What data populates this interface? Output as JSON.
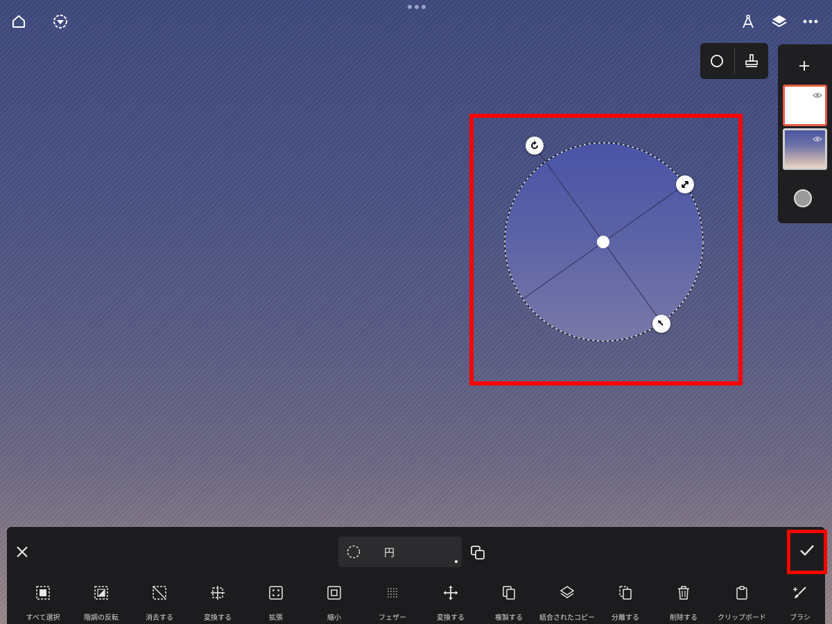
{
  "header": {
    "home_icon": "home-icon",
    "adjust_icon": "adjust-icon",
    "compass_icon": "compass-icon",
    "layers_icon": "layers-icon",
    "more_icon": "more-icon"
  },
  "tool_popover": {
    "shape_icon": "circle-outline-icon",
    "stamp_icon": "stamp-icon"
  },
  "layers_panel": {
    "add_icon": "plus-icon",
    "layers": [
      {
        "name": "layer-white",
        "selected": true,
        "visible": true
      },
      {
        "name": "layer-gradient",
        "selected": false,
        "visible": true
      }
    ],
    "color_swatch": "#9a9a9a"
  },
  "selection": {
    "shape": "circle",
    "frame_color": "#ff0000",
    "handles": [
      "rotate-handle-icon",
      "resize-handle-icon",
      "move-handle-icon"
    ]
  },
  "toolbar": {
    "close_icon": "close-icon",
    "shape_label": "円",
    "copy_icon": "duplicate-shape-icon",
    "confirm_icon": "checkmark-icon",
    "tools": [
      {
        "icon": "select-all-icon",
        "label": "すべて選択"
      },
      {
        "icon": "invert-icon",
        "label": "階調の反転"
      },
      {
        "icon": "clear-selection-icon",
        "label": "消去する"
      },
      {
        "icon": "transform-selection-icon",
        "label": "変換する"
      },
      {
        "icon": "expand-icon",
        "label": "拡張"
      },
      {
        "icon": "shrink-icon",
        "label": "縮小"
      },
      {
        "icon": "feather-icon",
        "label": "フェザー"
      },
      {
        "icon": "move-icon",
        "label": "変換する"
      },
      {
        "icon": "duplicate-icon",
        "label": "複製する"
      },
      {
        "icon": "merged-copy-icon",
        "label": "結合されたコピー"
      },
      {
        "icon": "separate-icon",
        "label": "分離する"
      },
      {
        "icon": "trash-icon",
        "label": "削除する"
      },
      {
        "icon": "clipboard-icon",
        "label": "クリップボード"
      },
      {
        "icon": "brush-icon",
        "label": "ブラシ"
      }
    ]
  }
}
